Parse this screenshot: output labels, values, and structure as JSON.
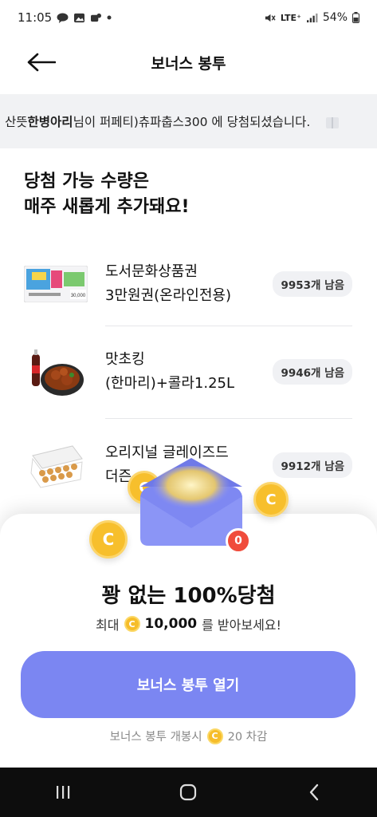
{
  "status_bar": {
    "time": "11:05",
    "network": "LTE⁺",
    "battery": "54%"
  },
  "header": {
    "title": "보너스 봉투"
  },
  "ticker": {
    "prefix": "산뜻",
    "winner": "한병아리",
    "rest": "님이 퍼페티)츄파춥스300 에 당첨되셨습니다."
  },
  "section": {
    "line1": "당첨 가능 수량은",
    "line2": "매주 새롭게 추가돼요!"
  },
  "prizes": [
    {
      "line1": "도서문화상품권",
      "line2": "3만원권(온라인전용)",
      "remaining": "9953개 남음",
      "thumb_label": "30,000"
    },
    {
      "line1": "맛초킹",
      "line2": "(한마리)+콜라1.25L",
      "remaining": "9946개 남음"
    },
    {
      "line1": "오리지널 글레이즈드",
      "line2": "더즌",
      "remaining": "9912개 남음"
    }
  ],
  "sheet": {
    "title": "꽝 없는 100%당첨",
    "sub_prefix": "최대",
    "sub_amount": "10,000",
    "sub_suffix": "를 받아보세요!",
    "button_label": "보너스 봉투 열기",
    "cost_prefix": "보너스 봉투 개봉시",
    "cost_value": "20 차감",
    "envelope_count": "0",
    "coin_symbol": "C"
  },
  "colors": {
    "accent": "#7b86f2",
    "coin": "#f7bf2c",
    "badge_red": "#f04c3c"
  }
}
